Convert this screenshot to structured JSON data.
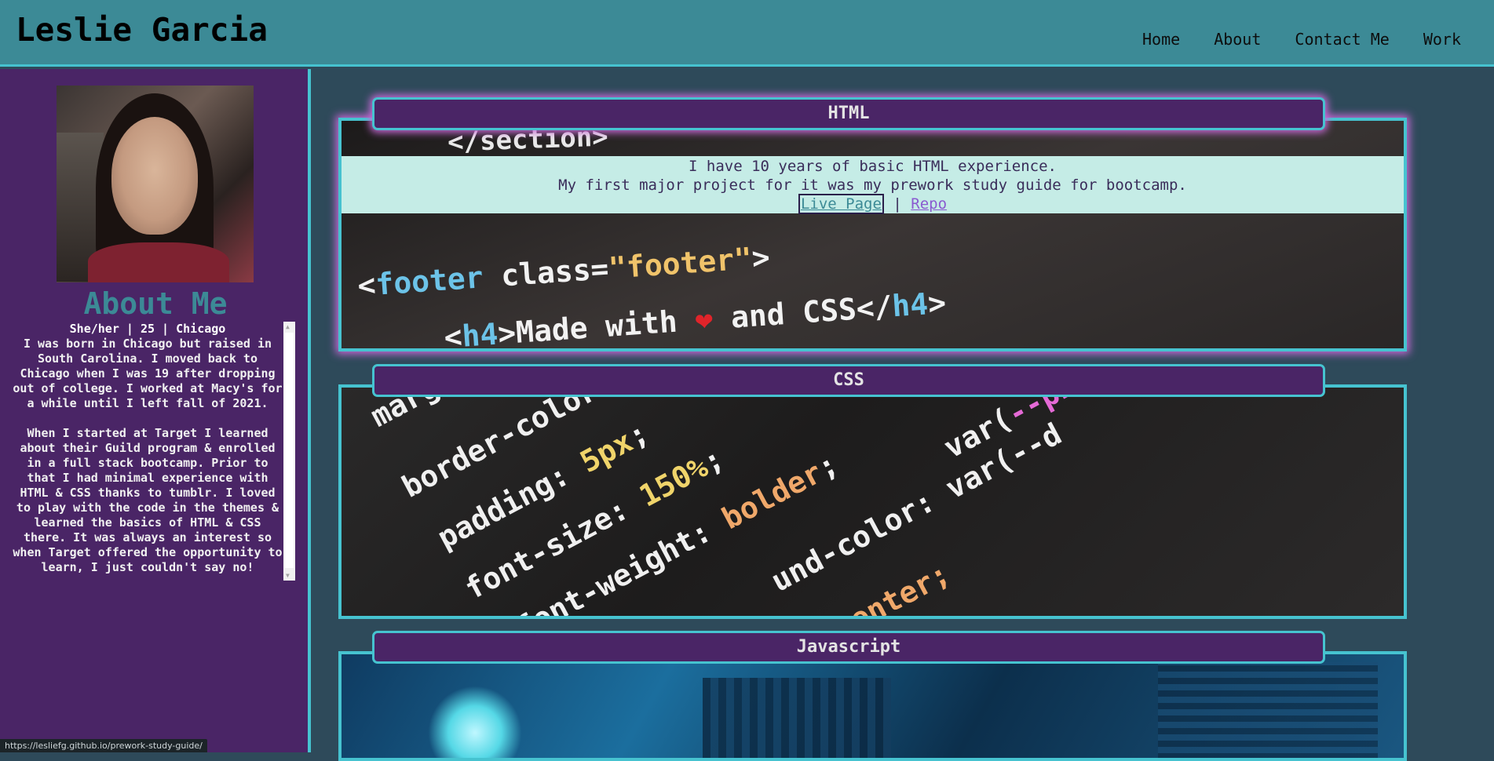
{
  "header": {
    "title": "Leslie Garcia",
    "nav": [
      "Home",
      "About",
      "Contact Me",
      "Work"
    ]
  },
  "sidebar": {
    "about_title": "About Me",
    "subtitle": "She/her | 25 | Chicago",
    "bio": "I was born in Chicago but raised in South Carolina. I moved back to Chicago when I was 19 after dropping out of college. I worked at Macy's for a while until I left fall of 2021.\n\nWhen I started at Target I learned about their Guild program & enrolled in a full stack bootcamp. Prior to that I had minimal experience with HTML & CSS thanks to tumblr. I loved to play with the code in the themes & learned the basics of HTML & CSS there. It was always an interest so when Target offered the opportunity to learn, I just couldn't say no!"
  },
  "projects": [
    {
      "title": "HTML",
      "description_1": "I have 10 years of basic HTML experience.",
      "description_2": "My first major project for it was my prework study guide for bootcamp.",
      "live_label": "Live Page",
      "separator": "|",
      "repo_label": "Repo"
    },
    {
      "title": "CSS"
    },
    {
      "title": "Javascript"
    }
  ],
  "status_bar": {
    "url": "https://lesliefg.github.io/prework-study-guide/"
  },
  "colors": {
    "header_bg": "#3c8a96",
    "accent": "#46c3d0",
    "sidebar_bg": "#4a2566",
    "main_bg": "#2e4a5a",
    "overlay_bg": "#c5ece6"
  }
}
